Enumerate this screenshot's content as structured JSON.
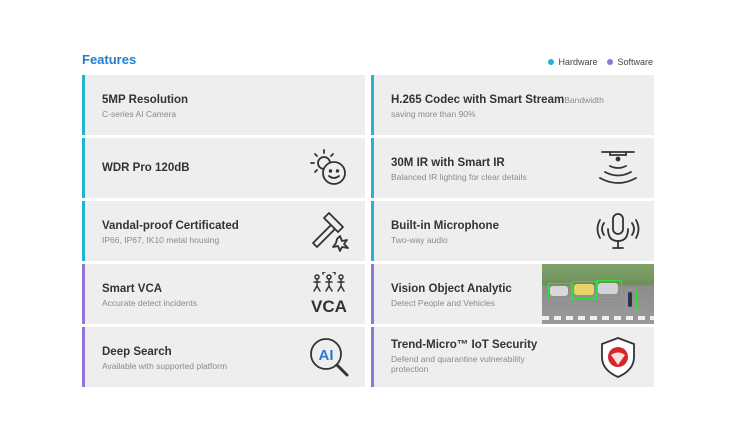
{
  "header": {
    "title": "Features"
  },
  "legend": [
    {
      "label": "Hardware",
      "color": "#22b3d2"
    },
    {
      "label": "Software",
      "color": "#9275d8"
    }
  ],
  "cards": {
    "c1": {
      "title": "5MP Resolution",
      "subtitle": "C-series AI Camera"
    },
    "c2": {
      "title": "H.265 Codec with Smart Stream",
      "inline": "Bandwidth",
      "subtitle": "saving more than 90%"
    },
    "c3": {
      "title": "WDR Pro 120dB",
      "icon": "wdr-sun-face-icon"
    },
    "c4": {
      "title": "30M IR with Smart IR",
      "subtitle": "Balanced IR lighting for clear details",
      "icon": "ir-waves-icon"
    },
    "c5": {
      "title": "Vandal-proof Certificated",
      "subtitle": "IP66, IP67, IK10 metal housing",
      "icon": "hammer-icon"
    },
    "c6": {
      "title": "Built-in Microphone",
      "subtitle": "Two-way audio",
      "icon": "microphone-icon"
    },
    "c7": {
      "title": "Smart VCA",
      "subtitle": "Accurate detect incidents",
      "icon_text": "VCA",
      "icon": "vca-people-icon"
    },
    "c8": {
      "title": "Vision Object Analytic",
      "subtitle": "Detect People and Vehicles",
      "icon": "street-detection-image"
    },
    "c9": {
      "title": "Deep Search",
      "subtitle": "Available with supported platform",
      "icon_text": "AI",
      "icon": "ai-search-icon"
    },
    "c10": {
      "title": "Trend-Micro™ IoT Security",
      "subtitle": "Defend and quarantine vulnerability protection",
      "icon": "trend-micro-shield-icon"
    }
  }
}
